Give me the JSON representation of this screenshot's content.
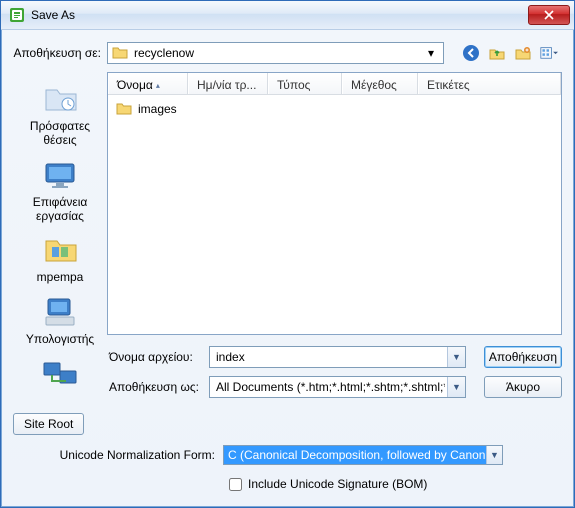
{
  "window": {
    "title": "Save As"
  },
  "topRow": {
    "saveInLabel": "Αποθήκευση σε:",
    "folderName": "recyclenow"
  },
  "navIcons": {
    "back": "back-icon",
    "up": "up-folder-icon",
    "newFolder": "new-folder-icon",
    "viewMenu": "view-menu-icon"
  },
  "places": [
    {
      "label": "Πρόσφατες θέσεις",
      "icon": "recent"
    },
    {
      "label": "Επιφάνεια εργασίας",
      "icon": "desktop"
    },
    {
      "label": "mpempa",
      "icon": "userfolder"
    },
    {
      "label": "Υπολογιστής",
      "icon": "computer"
    },
    {
      "label": "",
      "icon": "network"
    }
  ],
  "columns": {
    "name": "Όνομα",
    "date": "Ημ/νία τρ...",
    "type": "Τύπος",
    "size": "Μέγεθος",
    "tags": "Ετικέτες"
  },
  "listItems": [
    {
      "name": "images",
      "kind": "folder"
    }
  ],
  "form": {
    "filenameLabel": "Όνομα αρχείου:",
    "filenameValue": "index",
    "saveAsTypeLabel": "Αποθήκευση ως:",
    "saveAsTypeValue": "All Documents (*.htm;*.html;*.shtm;*.shtml;*.hta;*.htc;",
    "saveButton": "Αποθήκευση",
    "cancelButton": "Άκυρο"
  },
  "bottom": {
    "siteRoot": "Site Root",
    "normLabel": "Unicode Normalization Form:",
    "normValue": "C (Canonical Decomposition, followed by Canonical",
    "bomLabel": "Include Unicode Signature (BOM)",
    "bomChecked": false
  }
}
